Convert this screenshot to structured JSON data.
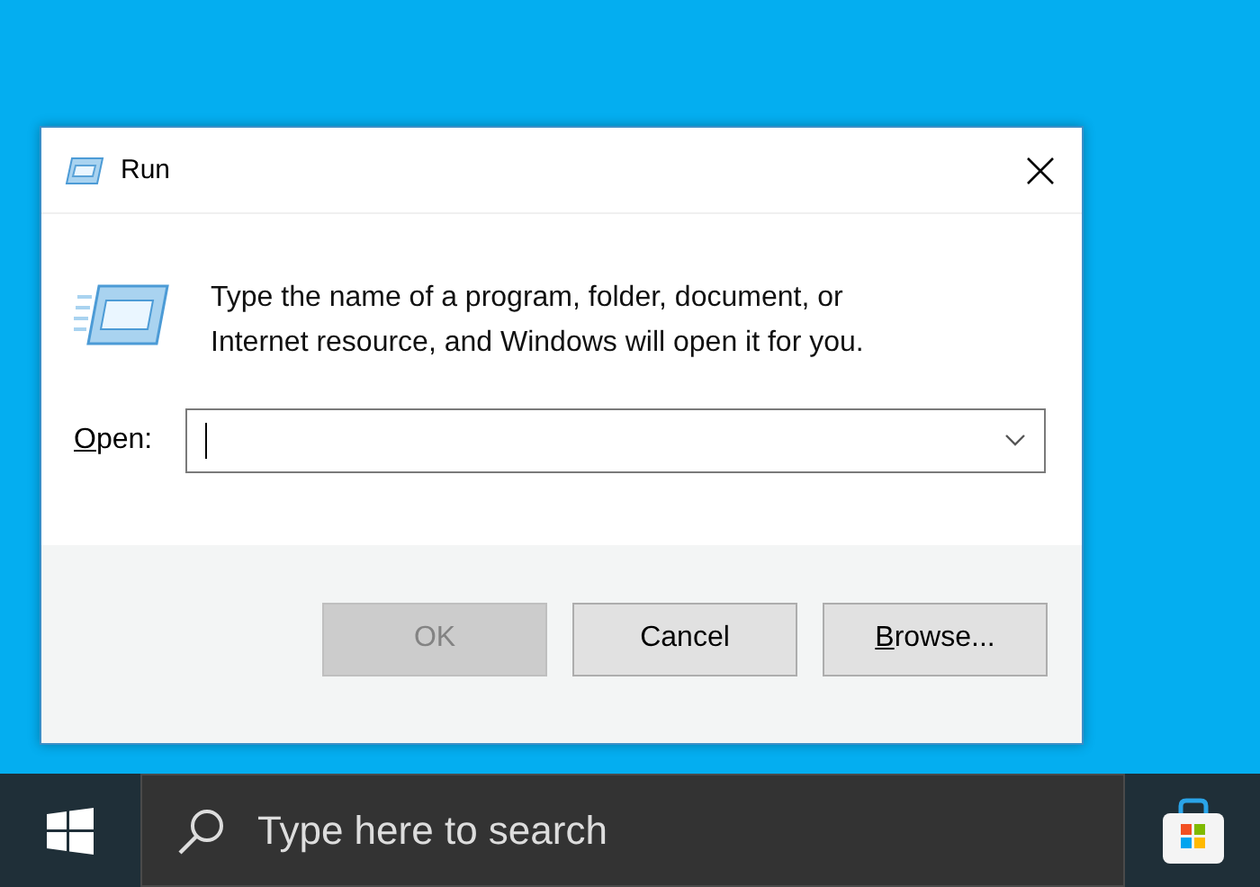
{
  "window": {
    "title": "Run"
  },
  "message": "Type the name of a program, folder, document, or Internet resource, and Windows will open it for you.",
  "open_field": {
    "access_key": "O",
    "label_rest": "pen:"
  },
  "buttons": [
    {
      "label": "OK",
      "disabled": true
    },
    {
      "label": "Cancel",
      "disabled": false
    },
    {
      "access_key": "B",
      "label": "rowse...",
      "disabled": false
    }
  ],
  "taskbar": {
    "search": {
      "placeholder": "Type here to search"
    }
  }
}
